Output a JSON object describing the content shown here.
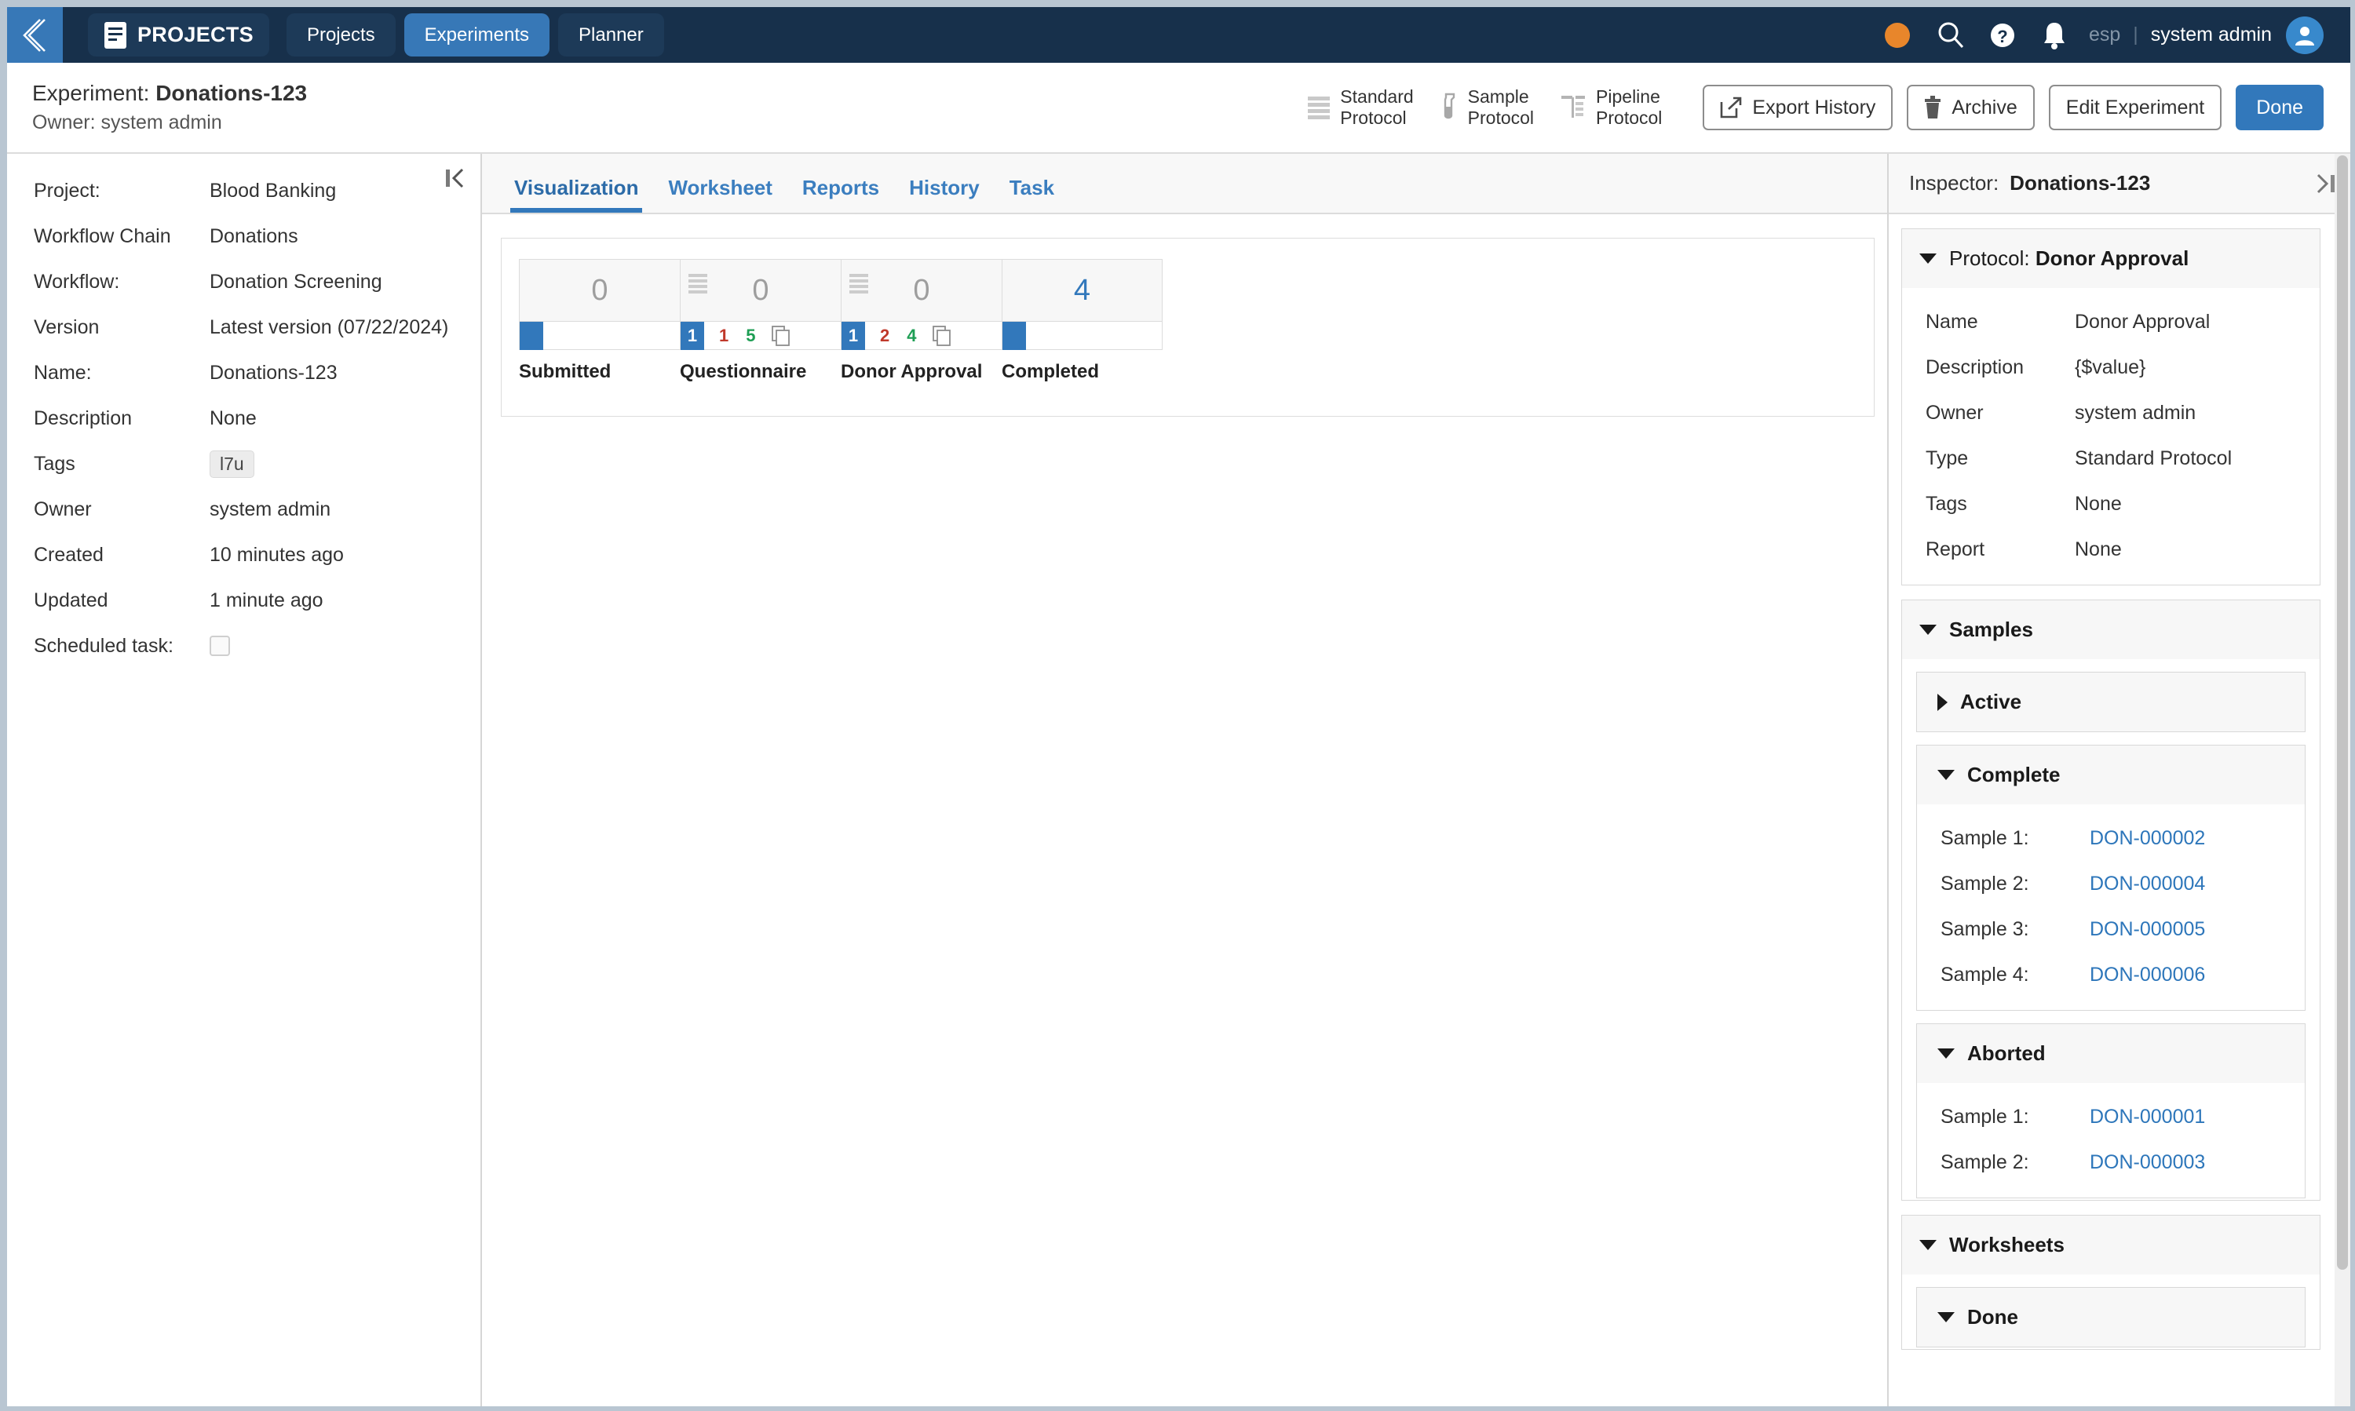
{
  "topnav": {
    "back_icon": "chevron-left-icon",
    "brand": {
      "icon": "document-list-icon",
      "label": "PROJECTS"
    },
    "tabs": [
      {
        "label": "Projects",
        "active": false
      },
      {
        "label": "Experiments",
        "active": true
      },
      {
        "label": "Planner",
        "active": false
      }
    ],
    "status_dot_color": "#e8862b",
    "icons": [
      "search-icon",
      "help-circle-icon",
      "bell-icon"
    ],
    "locale": "esp",
    "separator": "|",
    "user": "system admin",
    "avatar_icon": "user-avatar-icon"
  },
  "header": {
    "title_prefix": "Experiment:",
    "title_name": "Donations-123",
    "owner_line": "Owner: system admin",
    "protocol_shortcuts": [
      {
        "icon": "standard-protocol-icon",
        "line1": "Standard",
        "line2": "Protocol"
      },
      {
        "icon": "sample-protocol-icon",
        "line1": "Sample",
        "line2": "Protocol"
      },
      {
        "icon": "pipeline-protocol-icon",
        "line1": "Pipeline",
        "line2": "Protocol"
      }
    ],
    "buttons": [
      {
        "label": "Export History",
        "icon": "external-link-icon",
        "primary": false
      },
      {
        "label": "Archive",
        "icon": "trash-icon",
        "primary": false
      },
      {
        "label": "Edit Experiment",
        "icon": null,
        "primary": false
      },
      {
        "label": "Done",
        "icon": null,
        "primary": true
      }
    ]
  },
  "details": {
    "collapse_icon": "collapse-left-icon",
    "rows": [
      {
        "key": "Project:",
        "value": "Blood Banking",
        "type": "text"
      },
      {
        "key": "Workflow Chain",
        "value": "Donations",
        "type": "text"
      },
      {
        "key": "Workflow:",
        "value": "Donation Screening",
        "type": "text"
      },
      {
        "key": "Version",
        "value": "Latest version (07/22/2024)",
        "type": "text"
      },
      {
        "key": "Name:",
        "value": "Donations-123",
        "type": "text"
      },
      {
        "key": "Description",
        "value": "None",
        "type": "text"
      },
      {
        "key": "Tags",
        "value": "l7u",
        "type": "chip"
      },
      {
        "key": "Owner",
        "value": "system admin",
        "type": "text"
      },
      {
        "key": "Created",
        "value": "10 minutes ago",
        "type": "text"
      },
      {
        "key": "Updated",
        "value": "1 minute ago",
        "type": "text"
      },
      {
        "key": "Scheduled task:",
        "value": "",
        "type": "checkbox",
        "checked": false
      }
    ]
  },
  "main": {
    "tabs": [
      {
        "label": "Visualization",
        "active": true
      },
      {
        "label": "Worksheet",
        "active": false
      },
      {
        "label": "Reports",
        "active": false
      },
      {
        "label": "History",
        "active": false
      },
      {
        "label": "Task",
        "active": false
      }
    ]
  },
  "chart_data": {
    "type": "bar",
    "title": "",
    "xlabel": "",
    "ylabel": "",
    "categories": [
      "Submitted",
      "Questionnaire",
      "Donor Approval",
      "Completed"
    ],
    "values": [
      0,
      0,
      0,
      4
    ],
    "stage_details": [
      {
        "label": "Submitted",
        "count": "0",
        "count_active": false,
        "protocol_icon": null,
        "active_badge": null,
        "aborted": null,
        "complete": null,
        "copy_icon": null
      },
      {
        "label": "Questionnaire",
        "count": "0",
        "count_active": false,
        "protocol_icon": "standard-protocol-icon",
        "active_badge": "1",
        "aborted": "1",
        "complete": "5",
        "copy_icon": "copy-icon"
      },
      {
        "label": "Donor Approval",
        "count": "0",
        "count_active": false,
        "protocol_icon": "standard-protocol-icon",
        "active_badge": "1",
        "aborted": "2",
        "complete": "4",
        "copy_icon": "copy-icon"
      },
      {
        "label": "Completed",
        "count": "4",
        "count_active": true,
        "protocol_icon": null,
        "active_badge": null,
        "aborted": null,
        "complete": null,
        "copy_icon": null
      }
    ],
    "legend_colors": {
      "active": "#3278bb",
      "aborted": "#c0392b",
      "complete": "#1e9e54",
      "empty": "#9e9e9e"
    }
  },
  "inspector": {
    "head_label": "Inspector:",
    "head_value": "Donations-123",
    "expand_icon": "expand-right-icon",
    "protocol": {
      "title_prefix": "Protocol:",
      "title_name": "Donor Approval",
      "expanded": true,
      "rows": [
        {
          "key": "Name",
          "value": "Donor Approval"
        },
        {
          "key": "Description",
          "value": "{$value}"
        },
        {
          "key": "Owner",
          "value": "system admin"
        },
        {
          "key": "Type",
          "value": "Standard Protocol"
        },
        {
          "key": "Tags",
          "value": "None"
        },
        {
          "key": "Report",
          "value": "None"
        }
      ]
    },
    "samples": {
      "title": "Samples",
      "expanded": true,
      "groups": [
        {
          "title": "Active",
          "expanded": false,
          "items": []
        },
        {
          "title": "Complete",
          "expanded": true,
          "items": [
            {
              "key": "Sample 1:",
              "value": "DON-000002"
            },
            {
              "key": "Sample 2:",
              "value": "DON-000004"
            },
            {
              "key": "Sample 3:",
              "value": "DON-000005"
            },
            {
              "key": "Sample 4:",
              "value": "DON-000006"
            }
          ]
        },
        {
          "title": "Aborted",
          "expanded": true,
          "items": [
            {
              "key": "Sample 1:",
              "value": "DON-000001"
            },
            {
              "key": "Sample 2:",
              "value": "DON-000003"
            }
          ]
        }
      ]
    },
    "worksheets": {
      "title": "Worksheets",
      "expanded": true,
      "groups": [
        {
          "title": "Done",
          "expanded": true,
          "items": []
        }
      ]
    }
  }
}
